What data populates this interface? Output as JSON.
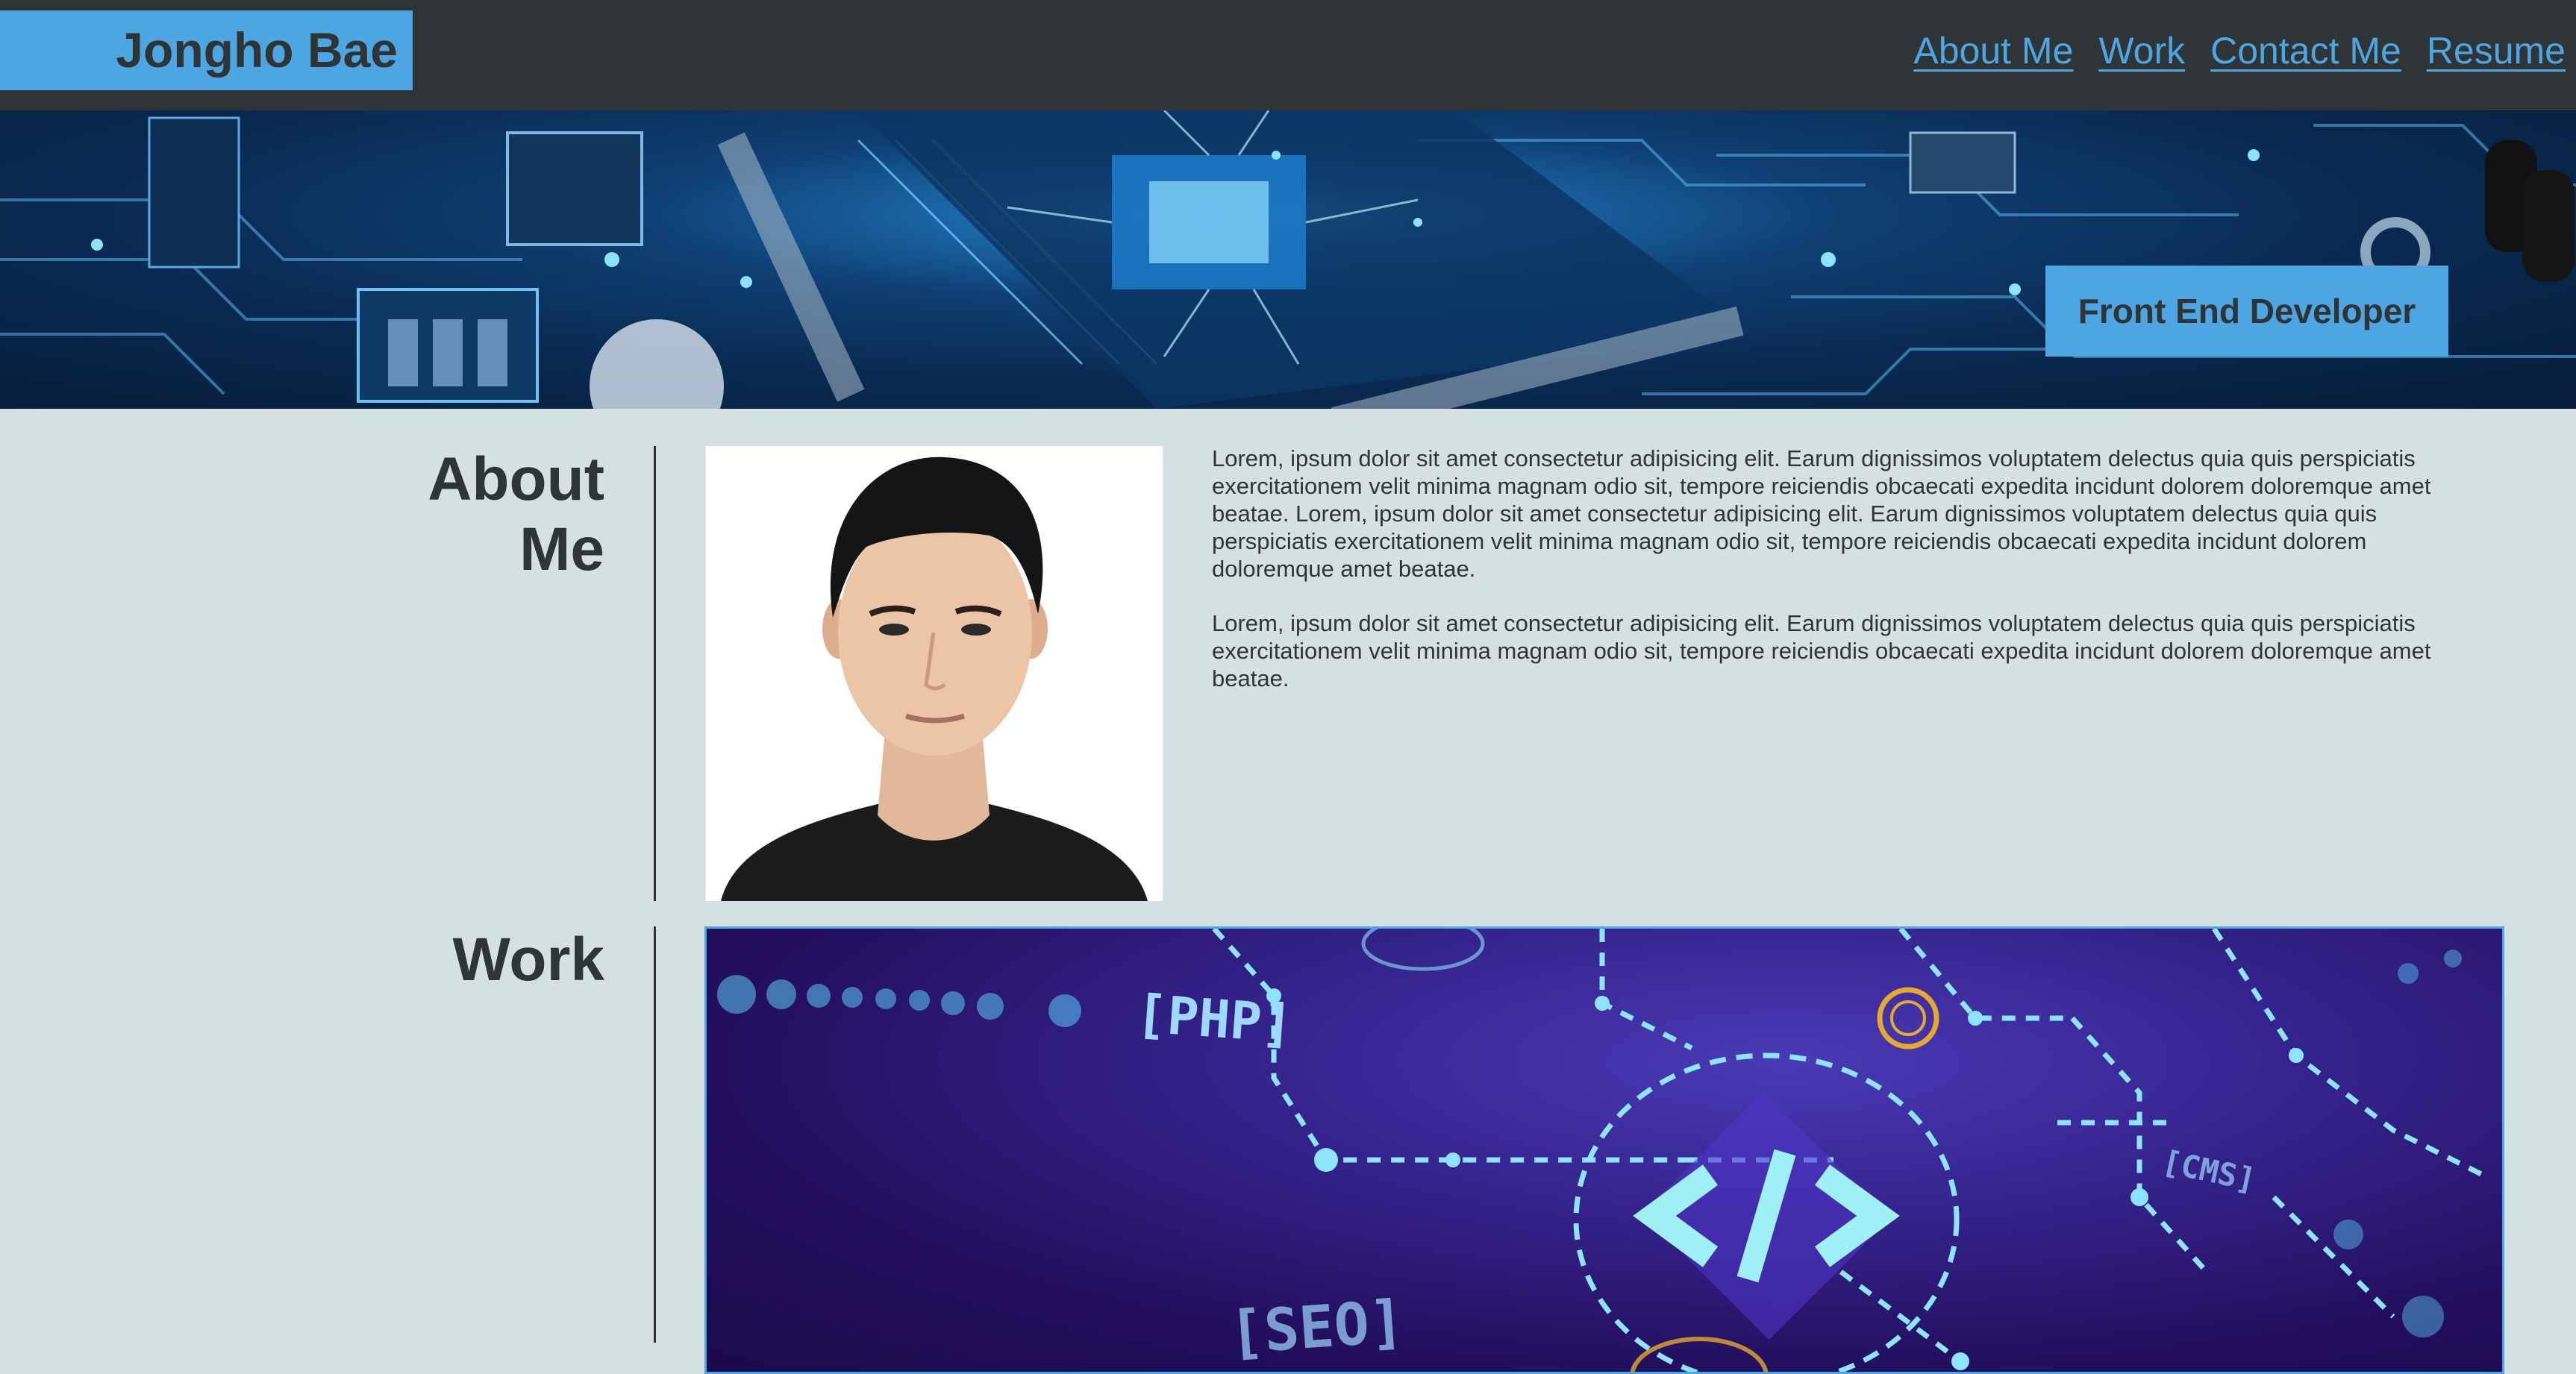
{
  "header": {
    "brand": "Jongho Bae",
    "nav": [
      "About Me",
      "Work",
      "Contact Me",
      "Resume"
    ]
  },
  "hero": {
    "badge": "Front End Developer"
  },
  "about": {
    "title": "About Me",
    "paragraphs": [
      "Lorem, ipsum dolor sit amet consectetur adipisicing elit. Earum dignissimos voluptatem delectus quia quis perspiciatis exercitationem velit minima magnam odio sit, tempore reiciendis obcaecati expedita incidunt dolorem doloremque amet beatae. Lorem, ipsum dolor sit amet consectetur adipisicing elit. Earum dignissimos voluptatem delectus quia quis perspiciatis exercitationem velit minima magnam odio sit, tempore reiciendis obcaecati expedita incidunt dolorem doloremque amet beatae.",
      "Lorem, ipsum dolor sit amet consectetur adipisicing elit. Earum dignissimos voluptatem delectus quia quis perspiciatis exercitationem velit minima magnam odio sit, tempore reiciendis obcaecati expedita incidunt dolorem doloremque amet beatae."
    ]
  },
  "work": {
    "title": "Work",
    "image_labels": [
      "[PHP]",
      "[SEO]",
      "[CMS]"
    ]
  },
  "colors": {
    "accent": "#4da5e2",
    "header_bg": "#2f3437",
    "page_bg": "#d5e0e3",
    "text": "#2f3437"
  }
}
